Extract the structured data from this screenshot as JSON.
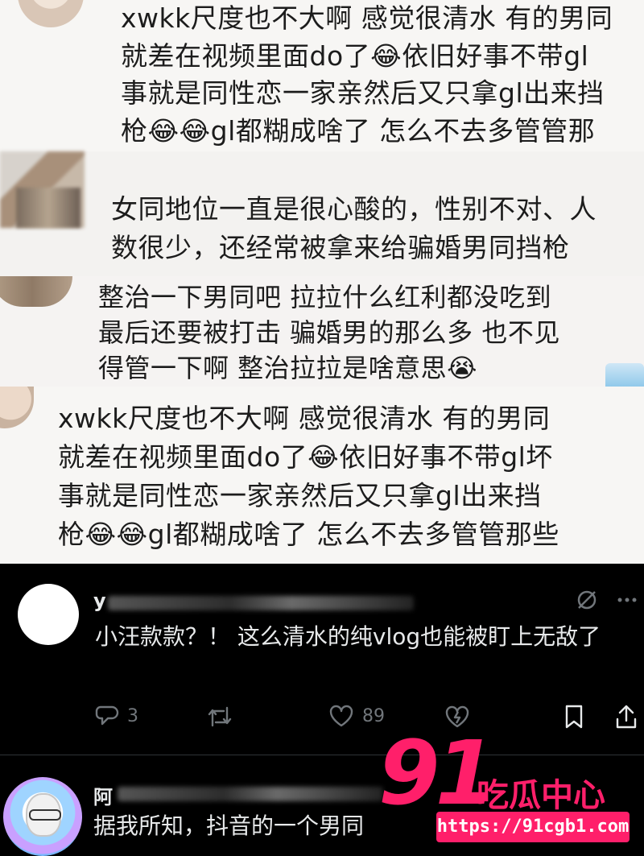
{
  "collage": {
    "block1": {
      "lines": [
        "xwkk尺度也不大啊 感觉很清水 有的男同",
        "就差在视频里面do了😂依旧好事不带gl",
        "事就是同性恋一家亲然后又只拿gl出来挡",
        "枪😂😂gl都糊成啥了 怎么不去多管管那"
      ]
    },
    "block2": {
      "lines": [
        "女同地位一直是很心酸的，性别不对、人",
        "数很少，还经常被拿来给骗婚男同挡枪"
      ]
    },
    "block3": {
      "lines": [
        "整治一下男同吧 拉拉什么红利都没吃到",
        "最后还要被打击 骗婚男的那么多 也不见",
        "得管一下啊 整治拉拉是啥意思😭"
      ]
    },
    "block4": {
      "lines": [
        "xwkk尺度也不大啊 感觉很清水 有的男同",
        "就差在视频里面do了😂依旧好事不带gl坏",
        "事就是同性恋一家亲然后又只拿gl出来挡",
        "枪😂😂gl都糊成啥了 怎么不去多管管那些"
      ]
    }
  },
  "tweets": [
    {
      "name_visible": "y",
      "body": "小汪款款？！ 这么清水的纯vlog也能被盯上无敌了",
      "replies": "3",
      "likes": "89",
      "icons": [
        "reply-icon",
        "retweet-icon",
        "like-icon",
        "broken-heart-icon",
        "bookmark-icon",
        "share-icon",
        "mute-icon",
        "more-icon"
      ]
    },
    {
      "name_visible": "阿",
      "body": "据我所知，抖音的一个男同"
    }
  ],
  "watermark": {
    "logo": "91",
    "text": "吃瓜中心",
    "url": "https://91cgb1.com"
  },
  "colors": {
    "tweet_bg": "#000000",
    "tweet_text": "#e7e9ea",
    "tweet_muted": "#71767b",
    "watermark_pink": "#ff1f6a"
  }
}
